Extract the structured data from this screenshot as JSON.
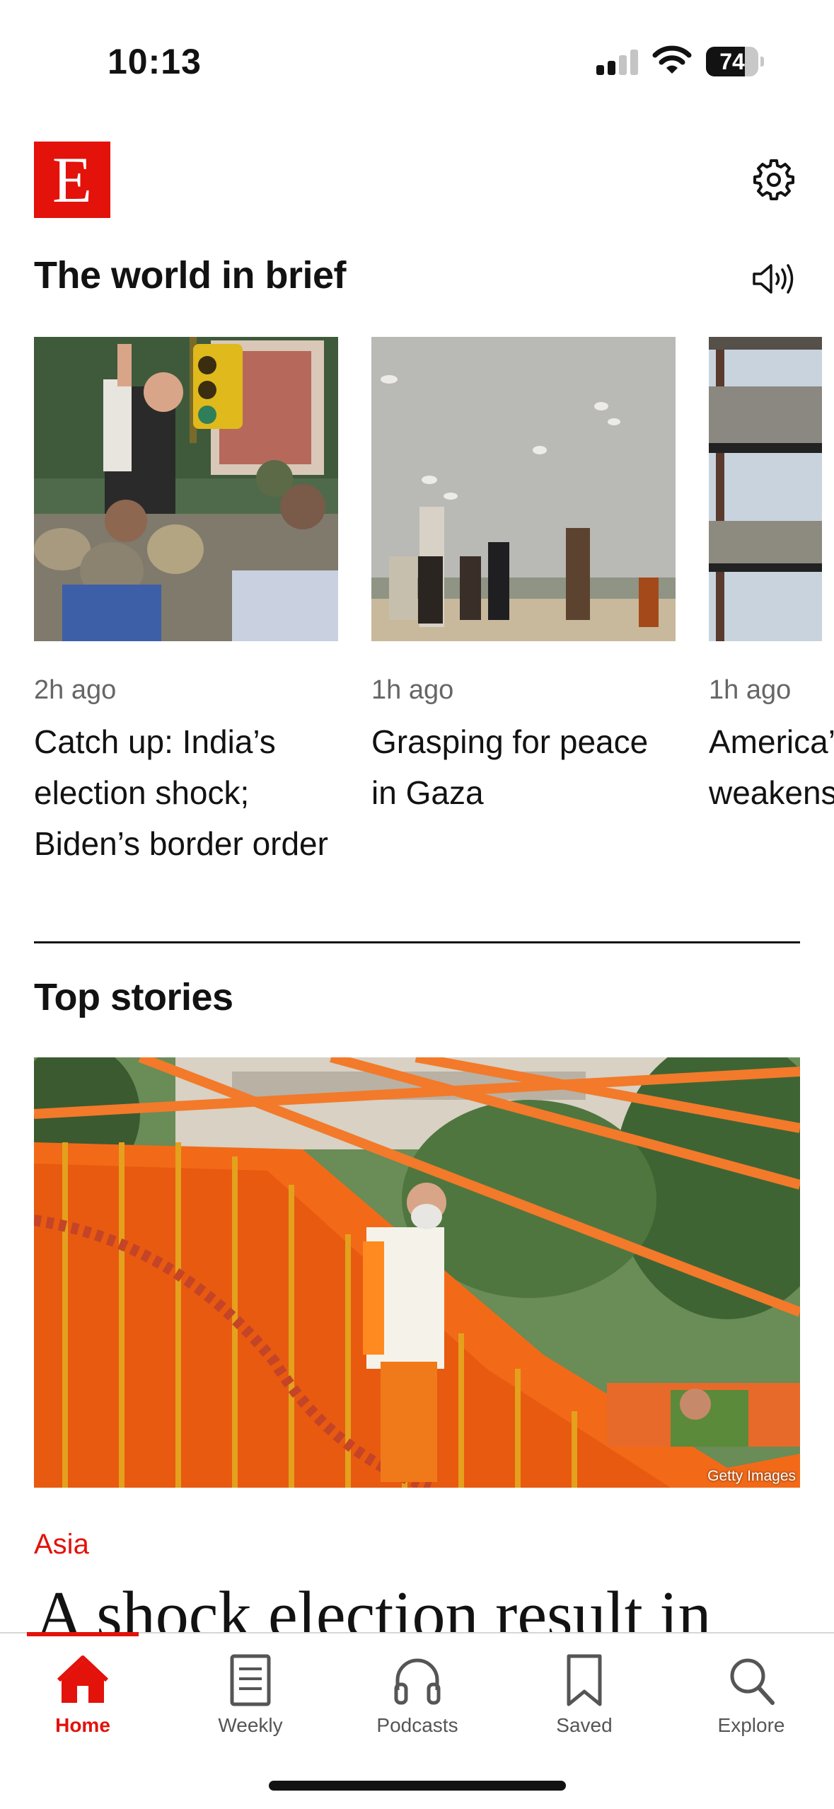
{
  "status_bar": {
    "time": "10:13",
    "battery_percent": 74,
    "battery_label": "74",
    "signal_bars_active": 2,
    "signal_bars_total": 4
  },
  "header": {
    "logo_letter": "E",
    "settings_icon": "gear-icon"
  },
  "brief": {
    "title": "The world in brief",
    "audio_icon": "speaker-icon",
    "items": [
      {
        "time": "2h ago",
        "headline": "Catch up: India’s election shock; Biden’s border order"
      },
      {
        "time": "1h ago",
        "headline": "Grasping for peace in Gaza"
      },
      {
        "time": "1h ago",
        "headline": "America’s weakens"
      }
    ]
  },
  "top_stories": {
    "title": "Top stories",
    "lead": {
      "image_credit": "Getty Images",
      "section": "Asia",
      "headline": "A shock election result in"
    }
  },
  "tabbar": {
    "tabs": [
      {
        "label": "Home",
        "icon": "home-icon",
        "active": true
      },
      {
        "label": "Weekly",
        "icon": "document-icon",
        "active": false
      },
      {
        "label": "Podcasts",
        "icon": "headphones-icon",
        "active": false
      },
      {
        "label": "Saved",
        "icon": "bookmark-icon",
        "active": false
      },
      {
        "label": "Explore",
        "icon": "search-icon",
        "active": false
      }
    ]
  },
  "colors": {
    "brand_red": "#e3120b",
    "text": "#121212",
    "muted": "#666666"
  }
}
